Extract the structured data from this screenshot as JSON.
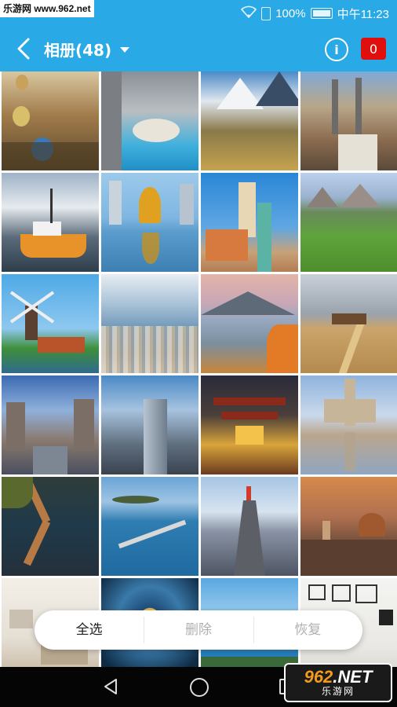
{
  "watermark": {
    "top_left": "乐游网 www.962.net",
    "brand_num": "962",
    "brand_net": ".NET",
    "brand_sub": "乐游网"
  },
  "status_bar": {
    "battery": "100%",
    "time": "中午11:23"
  },
  "header": {
    "title": "相册(48)",
    "badge_count": "0",
    "info_label": "i"
  },
  "actions": {
    "select_all": "全选",
    "delete": "删除",
    "restore": "恢复"
  },
  "colors": {
    "header_bg": "#29a9e6",
    "badge_bg": "#e10e0e",
    "nav_bg": "#050505"
  },
  "photos": [
    "balloons-valley",
    "coastal-cliff-beach",
    "snowy-mountains-field",
    "old-town-aerial",
    "winter-fishing-boat",
    "golden-statue-reflection",
    "castle-towers",
    "alpine-meadow",
    "windmill-lake",
    "coastal-town",
    "lake-mountain-sunset",
    "wheat-field-path",
    "gothic-street",
    "modern-skyscraper",
    "pagoda-night",
    "monument-reflection",
    "zigzag-bridge",
    "ocean-road-bridge",
    "cliff-figure",
    "cathedral-dusk",
    "living-room",
    "spiral-interior",
    "blue-sea",
    "gallery-room"
  ]
}
